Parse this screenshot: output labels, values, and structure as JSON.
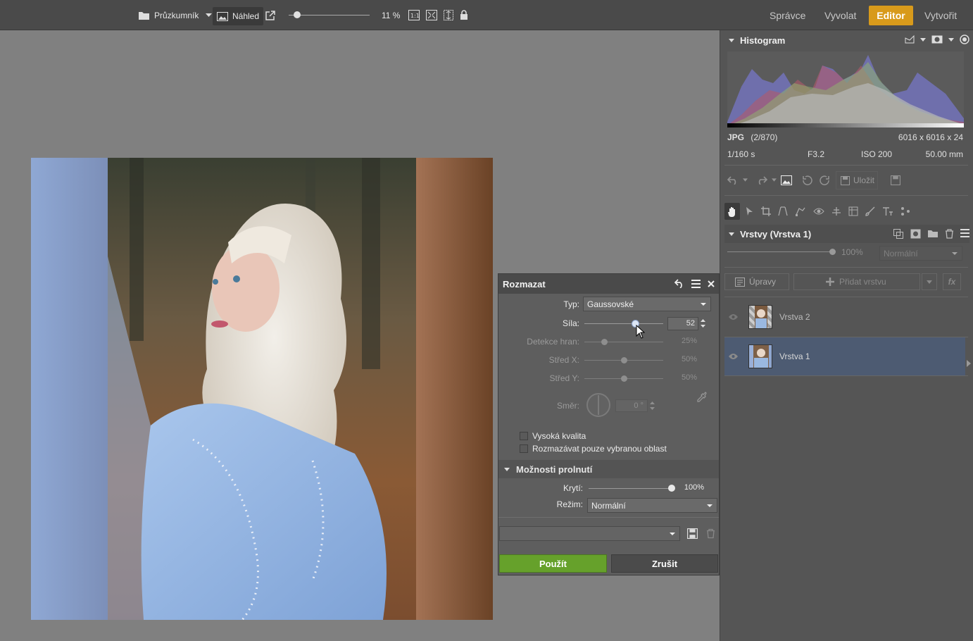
{
  "toolbar": {
    "browser_label": "Průzkumník",
    "preview_label": "Náhled",
    "zoom_value": "11 %",
    "zoom_slider_fraction": 0.1,
    "modes": [
      {
        "label": "Správce",
        "active": false
      },
      {
        "label": "Vyvolat",
        "active": false
      },
      {
        "label": "Editor",
        "active": true
      },
      {
        "label": "Vytvořit",
        "active": false
      }
    ]
  },
  "histogram": {
    "title": "Histogram",
    "format": "JPG",
    "index": "(2/870)",
    "dimensions": "6016 x 6016 x 24",
    "shutter": "1/160 s",
    "aperture": "F3.2",
    "iso": "ISO 200",
    "focal": "50.00 mm"
  },
  "edit_toolbar": {
    "save_label": "Uložit"
  },
  "layers": {
    "title": "Vrstvy (Vrstva 1)",
    "opacity": "100%",
    "blend_mode": "Normální",
    "adjustments_label": "Úpravy",
    "add_layer_label": "Přidat vrstvu",
    "fx_label": "fx",
    "items": [
      {
        "name": "Vrstva 2",
        "selected": false
      },
      {
        "name": "Vrstva 1",
        "selected": true
      }
    ]
  },
  "blur_dialog": {
    "title": "Rozmazat",
    "type_label": "Typ:",
    "type_value": "Gaussovské",
    "strength_label": "Síla:",
    "strength_value": "52",
    "strength_fraction": 0.65,
    "edge_label": "Detekce hran:",
    "edge_value": "25%",
    "edge_fraction": 0.25,
    "centerx_label": "Střed X:",
    "centerx_value": "50%",
    "centerx_fraction": 0.5,
    "centery_label": "Střed Y:",
    "centery_value": "50%",
    "centery_fraction": 0.5,
    "direction_label": "Směr:",
    "direction_value": "0 °",
    "high_quality_label": "Vysoká kvalita",
    "selection_only_label": "Rozmazávat pouze vybranou oblast",
    "blend_section_title": "Možnosti prolnutí",
    "opacity_label": "Krytí:",
    "opacity_value": "100%",
    "opacity_fraction": 1.0,
    "mode_label": "Režim:",
    "mode_value": "Normální",
    "preset_value": "",
    "apply_label": "Použít",
    "cancel_label": "Zrušit"
  },
  "colors": {
    "accent": "#d89a1b",
    "apply": "#66a12b",
    "selected_layer": "#4d5b72"
  }
}
